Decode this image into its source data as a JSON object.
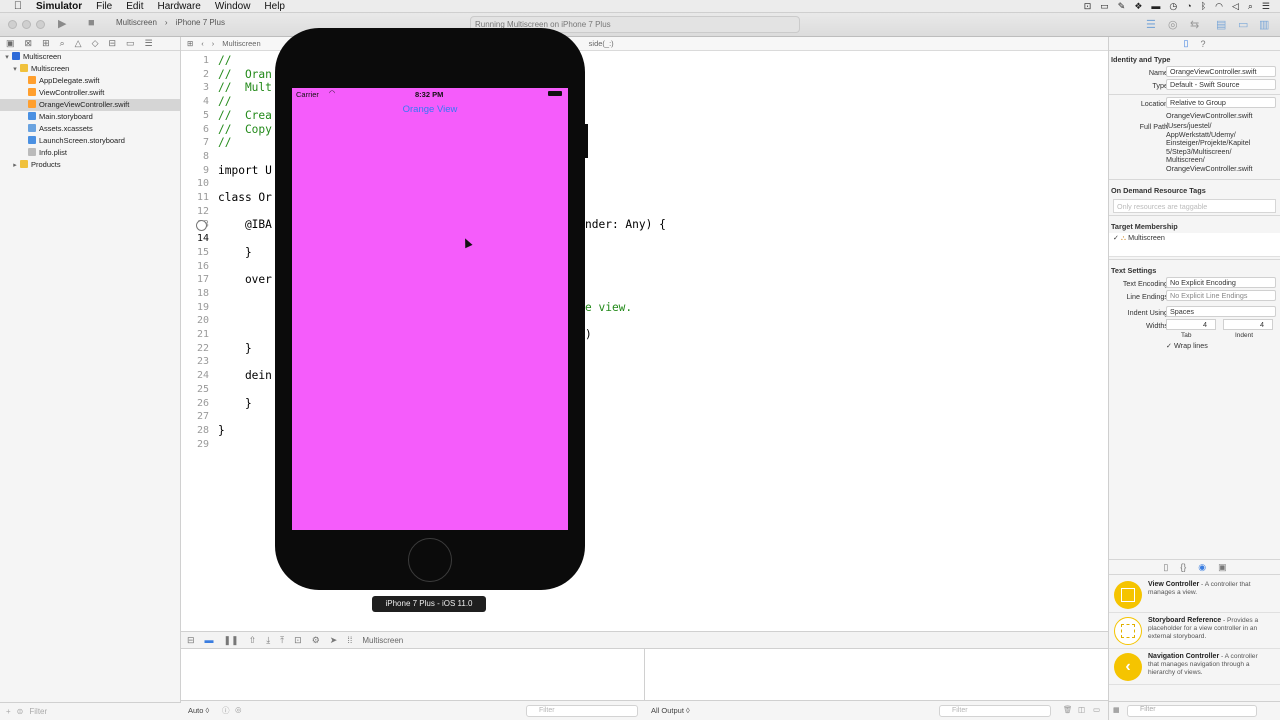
{
  "menubar": {
    "app": "Simulator",
    "items": [
      "File",
      "Edit",
      "Hardware",
      "Window",
      "Help"
    ]
  },
  "toolbar": {
    "scheme": "Multiscreen",
    "device": "iPhone 7 Plus",
    "activity": "Running Multiscreen on iPhone 7 Plus"
  },
  "navigator": {
    "rows": [
      {
        "label": "Multiscreen",
        "icon": "project-icon",
        "indent": 0,
        "disclosure": "▾"
      },
      {
        "label": "Multiscreen",
        "icon": "folder-icon",
        "indent": 1,
        "disclosure": "▾"
      },
      {
        "label": "AppDelegate.swift",
        "icon": "swift-file-icon",
        "indent": 2,
        "disclosure": ""
      },
      {
        "label": "ViewController.swift",
        "icon": "swift-file-icon",
        "indent": 2,
        "disclosure": ""
      },
      {
        "label": "OrangeViewController.swift",
        "icon": "swift-file-icon",
        "indent": 2,
        "disclosure": "",
        "selected": true
      },
      {
        "label": "Main.storyboard",
        "icon": "storyboard-icon",
        "indent": 2,
        "disclosure": ""
      },
      {
        "label": "Assets.xcassets",
        "icon": "assets-icon",
        "indent": 2,
        "disclosure": ""
      },
      {
        "label": "LaunchScreen.storyboard",
        "icon": "storyboard-icon",
        "indent": 2,
        "disclosure": ""
      },
      {
        "label": "Info.plist",
        "icon": "plist-icon",
        "indent": 2,
        "disclosure": ""
      },
      {
        "label": "Products",
        "icon": "folder-icon",
        "indent": 1,
        "disclosure": "▸"
      }
    ],
    "filter_placeholder": "Filter"
  },
  "jumpbar": {
    "crumb": "Multiscreen",
    "tail": "side(_:)"
  },
  "editor": {
    "lines": [
      {
        "n": "1",
        "code": "//",
        "cls": "cm"
      },
      {
        "n": "2",
        "code": "//  Oran",
        "cls": "cm"
      },
      {
        "n": "3",
        "code": "//  Mult",
        "cls": "cm"
      },
      {
        "n": "4",
        "code": "//",
        "cls": "cm"
      },
      {
        "n": "5",
        "code": "//  Crea",
        "cls": "cm"
      },
      {
        "n": "6",
        "code": "//  Copy",
        "cls": "cm"
      },
      {
        "n": "7",
        "code": "//",
        "cls": "cm"
      },
      {
        "n": "8",
        "code": "",
        "cls": ""
      },
      {
        "n": "9",
        "code": "import U",
        "cls": ""
      },
      {
        "n": "10",
        "code": "",
        "cls": ""
      },
      {
        "n": "11",
        "code": "class Or",
        "cls": ""
      },
      {
        "n": "12",
        "code": "",
        "cls": ""
      },
      {
        "n": "13",
        "code": "    @IBA",
        "cls": ""
      },
      {
        "n": "14",
        "code": "",
        "cls": ""
      },
      {
        "n": "15",
        "code": "    }",
        "cls": ""
      },
      {
        "n": "16",
        "code": "",
        "cls": ""
      },
      {
        "n": "17",
        "code": "    over",
        "cls": ""
      },
      {
        "n": "18",
        "code": "",
        "cls": ""
      },
      {
        "n": "19",
        "code": "",
        "cls": ""
      },
      {
        "n": "20",
        "code": "",
        "cls": ""
      },
      {
        "n": "21",
        "code": "",
        "cls": ""
      },
      {
        "n": "22",
        "code": "    }",
        "cls": ""
      },
      {
        "n": "23",
        "code": "",
        "cls": ""
      },
      {
        "n": "24",
        "code": "    dein",
        "cls": ""
      },
      {
        "n": "25",
        "code": "",
        "cls": ""
      },
      {
        "n": "26",
        "code": "    }",
        "cls": ""
      },
      {
        "n": "27",
        "code": "",
        "cls": ""
      },
      {
        "n": "28",
        "code": "}",
        "cls": ""
      },
      {
        "n": "29",
        "code": "",
        "cls": ""
      }
    ],
    "fragment_13": "nder: Any) {",
    "fragment_19": "e view.",
    "fragment_21": ")"
  },
  "debug": {
    "scheme_label": "Multiscreen",
    "auto_label": "Auto ◊",
    "output_label": "All Output ◊",
    "filter_placeholder": "Filter"
  },
  "inspector": {
    "identity_title": "Identity and Type",
    "name_label": "Name",
    "name_value": "OrangeViewController.swift",
    "type_label": "Type",
    "type_value": "Default - Swift Source",
    "location_label": "Location",
    "location_value": "Relative to Group",
    "location_file": "OrangeViewController.swift",
    "fullpath_label": "Full Path",
    "fullpath_lines": [
      "/Users/juestel/",
      "AppWerkstatt/Udemy/",
      "Einsteiger/Projekte/Kapitel",
      "5/Step3/Multiscreen/",
      "Multiscreen/",
      "OrangeViewController.swift"
    ],
    "odr_title": "On Demand Resource Tags",
    "odr_placeholder": "Only resources are taggable",
    "target_title": "Target Membership",
    "target_item": "Multiscreen",
    "text_title": "Text Settings",
    "encoding_label": "Text Encoding",
    "encoding_value": "No Explicit Encoding",
    "endings_label": "Line Endings",
    "endings_value": "No Explicit Line Endings",
    "indent_label": "Indent Using",
    "indent_value": "Spaces",
    "widths_label": "Widths",
    "tab_value": "4",
    "indent_width_value": "4",
    "tab_caption": "Tab",
    "indent_caption": "Indent",
    "wrap_label": "Wrap lines",
    "library": [
      {
        "title": "View Controller",
        "desc": " - A controller that manages a view.",
        "style": "filled",
        "glyph": ""
      },
      {
        "title": "Storyboard Reference",
        "desc": " - Provides a placeholder for a view controller in an external storyboard.",
        "style": "outline",
        "glyph": ""
      },
      {
        "title": "Navigation Controller",
        "desc": " - A controller that manages navigation through a hierarchy of views.",
        "style": "filled",
        "glyph": "‹"
      }
    ],
    "filter_placeholder": "Filter"
  },
  "simulator": {
    "carrier": "Carrier",
    "time": "8:32 PM",
    "nav_title": "Orange View",
    "device_label": "iPhone 7 Plus - iOS 11.0",
    "screen_color": "#f55cfb",
    "title_color": "#3478f6"
  }
}
